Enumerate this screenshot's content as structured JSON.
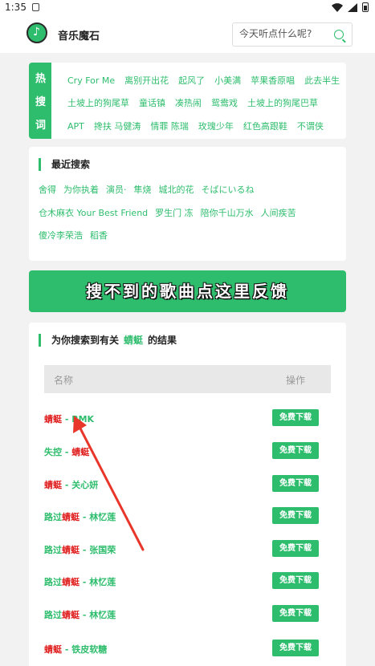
{
  "status_bar": {
    "time": "1:35"
  },
  "header": {
    "app_name": "音乐魔石",
    "search_placeholder": "今天听点什么呢?"
  },
  "hot_search": {
    "label_chars": [
      "热",
      "搜",
      "词"
    ],
    "rows": [
      [
        "Cry For Me",
        "离别开出花",
        "起风了",
        "小美满",
        "苹果香原唱",
        "此去半生"
      ],
      [
        "土坡上的狗尾草",
        "童话镇",
        "凑热闹",
        "鸳鸯戏",
        "土坡上的狗尾巴草"
      ],
      [
        "APT",
        "搀扶 马健涛",
        "情罪 陈瑞",
        "玫瑰少年",
        "红色高跟鞋",
        "不谓侠"
      ]
    ]
  },
  "recent_search": {
    "title": "最近搜索",
    "rows": [
      [
        "舍得",
        "为你执着",
        "演员·",
        "隼烧",
        "城北的花",
        "そばにいるね"
      ],
      [
        "仓木麻衣 Your Best Friend",
        "罗生门 冻",
        "陪你千山万水",
        "人间疾苦"
      ],
      [
        "傻冷李荣浩",
        "稻香"
      ]
    ]
  },
  "feedback_banner": "搜不到的歌曲点这里反馈",
  "results": {
    "prefix": "为你搜索到有关",
    "keyword": "蜻蜓",
    "suffix": "的结果",
    "col_name": "名称",
    "col_action": "操作",
    "download_label": "免费下载",
    "items": [
      {
        "pre": "",
        "kw": "蜻蜓",
        "post": " - BMK",
        "style": "red"
      },
      {
        "pre": "失控 - ",
        "kw": "蜻蜓",
        "post": "",
        "style": "green"
      },
      {
        "pre": "",
        "kw": "蜻蜓",
        "post": " - 关心妍",
        "style": "red"
      },
      {
        "pre": "路过",
        "kw": "蜻蜓",
        "post": " - 林忆莲",
        "style": "green"
      },
      {
        "pre": "路过",
        "kw": "蜻蜓",
        "post": " - 张国荣",
        "style": "green"
      },
      {
        "pre": "路过",
        "kw": "蜻蜓",
        "post": " - 林忆莲",
        "style": "green"
      },
      {
        "pre": "路过",
        "kw": "蜻蜓",
        "post": " - 林忆莲",
        "style": "green"
      },
      {
        "pre": "",
        "kw": "蜻蜓",
        "post": " - 铁皮软糖",
        "style": "red"
      }
    ]
  },
  "colors": {
    "accent": "#2ebd6d",
    "highlight": "#e02020",
    "annotation_arrow": "#e8362a"
  }
}
